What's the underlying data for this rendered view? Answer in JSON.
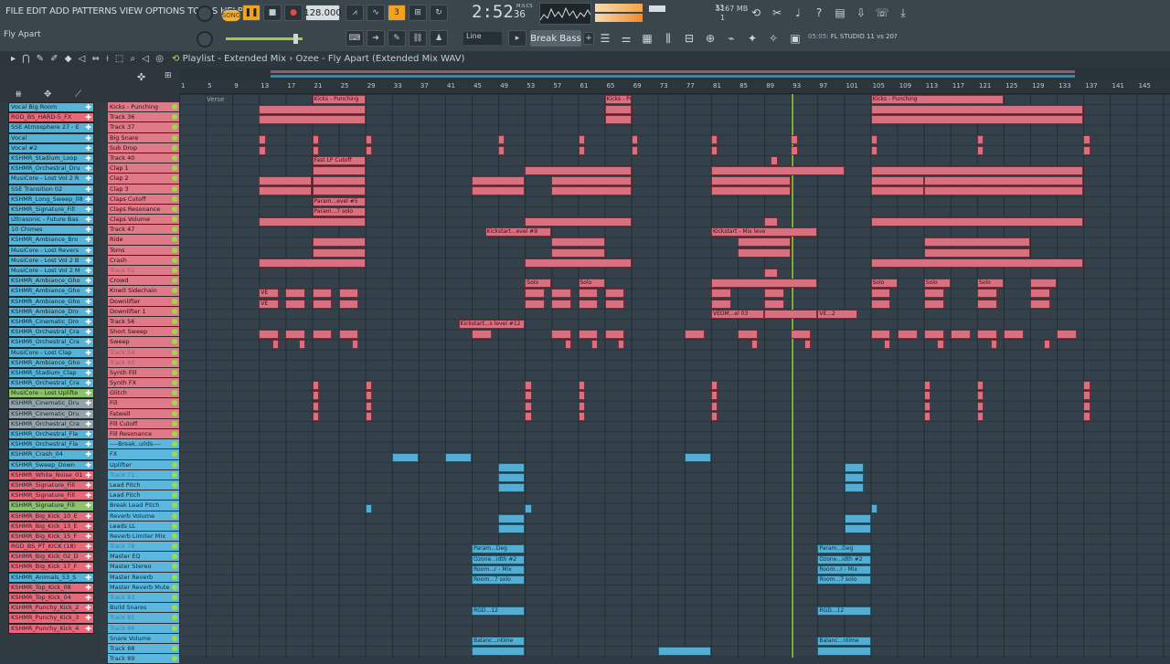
{
  "menu": [
    "FILE",
    "EDIT",
    "ADD",
    "PATTERNS",
    "VIEW",
    "OPTIONS",
    "TOOLS",
    "HELP"
  ],
  "hint_text": "Fly Apart",
  "transport": {
    "mode": "SONG",
    "tempo": "128.000",
    "time": "2:52",
    "time_sub": "36",
    "time_label": "M:S:CS"
  },
  "cpu": {
    "value": "33",
    "memory": "5167 MB",
    "voices": "1"
  },
  "snap": "Line",
  "pattern": "Break Bass",
  "info": {
    "pre": "05:05:",
    "text": "FL STUDIO 11 vs 20?"
  },
  "playlist": {
    "title": "Playlist - Extended Mix",
    "sep": "›",
    "song": "Ozee - Fly Apart (Extended Mix WAV)",
    "marker": "Verse"
  },
  "ruler": [
    "1",
    "5",
    "9",
    "13",
    "17",
    "21",
    "25",
    "29",
    "33",
    "37",
    "41",
    "45",
    "49",
    "53",
    "57",
    "61",
    "65",
    "69",
    "73",
    "77",
    "81",
    "85",
    "89",
    "93",
    "97",
    "101",
    "105",
    "109",
    "113",
    "117",
    "121",
    "125",
    "129",
    "133",
    "137",
    "141",
    "145"
  ],
  "channels": [
    {
      "name": "Vocal Big Room",
      "color": "blue"
    },
    {
      "name": "RGD_BS_HARD-5_FX",
      "color": "red"
    },
    {
      "name": "SSE Atmosphere 27 - E",
      "color": "blue"
    },
    {
      "name": "Vocal",
      "color": "blue"
    },
    {
      "name": "Vocal #2",
      "color": "blue"
    },
    {
      "name": "KSHMR_Stadium_Loop",
      "color": "blue"
    },
    {
      "name": "KSHMR_Orchestral_Dru",
      "color": "blue"
    },
    {
      "name": "MusiCore - Lost Vol 2 R",
      "color": "blue"
    },
    {
      "name": "SSE Transition 02",
      "color": "blue"
    },
    {
      "name": "KSHMR_Long_Sweep_08",
      "color": "blue"
    },
    {
      "name": "KSHMR_Signature_Fill",
      "color": "blue"
    },
    {
      "name": "Ultrasonic - Future Bas",
      "color": "blue"
    },
    {
      "name": "10 Chimes",
      "color": "blue"
    },
    {
      "name": "KSHMR_Ambiance_Bro",
      "color": "blue"
    },
    {
      "name": "MusiCore - Lost Revers",
      "color": "blue"
    },
    {
      "name": "MusiCore - Lost Vol 2 B",
      "color": "blue"
    },
    {
      "name": "MusiCore - Lost Vol 2 M",
      "color": "blue"
    },
    {
      "name": "KSHMR_Ambiance_Gho",
      "color": "blue"
    },
    {
      "name": "KSHMR_Ambiance_Gho",
      "color": "blue"
    },
    {
      "name": "KSHMR_Ambiance_Gho",
      "color": "blue"
    },
    {
      "name": "KSHMR_Ambiance_Dro",
      "color": "blue"
    },
    {
      "name": "KSHMR_Cinematic_Dro",
      "color": "blue"
    },
    {
      "name": "KSHMR_Orchestral_Cra",
      "color": "blue"
    },
    {
      "name": "KSHMR_Orchestral_Cra",
      "color": "blue"
    },
    {
      "name": "MusiCore - Lost Clap",
      "color": "blue"
    },
    {
      "name": "KSHMR_Ambiance_Gho",
      "color": "blue"
    },
    {
      "name": "KSHMR_Stadium_Clap",
      "color": "blue"
    },
    {
      "name": "KSHMR_Orchestral_Cra",
      "color": "blue"
    },
    {
      "name": "MusiCore - Lost Uplifte",
      "color": "green"
    },
    {
      "name": "KSHMR_Cinematic_Dru",
      "color": "grey"
    },
    {
      "name": "KSHMR_Cinematic_Dru",
      "color": "grey"
    },
    {
      "name": "KSHMR_Orchestral_Cra",
      "color": "grey"
    },
    {
      "name": "KSHMR_Orchestral_Fla",
      "color": "blue"
    },
    {
      "name": "KSHMR_Orchestral_Fla",
      "color": "blue"
    },
    {
      "name": "KSHMR_Crash_04",
      "color": "blue"
    },
    {
      "name": "KSHMR_Sweep_Down",
      "color": "blue"
    },
    {
      "name": "KSHMR_White_Noise_01",
      "color": "red"
    },
    {
      "name": "KSHMR_Signature_Fill",
      "color": "red"
    },
    {
      "name": "KSHMR_Signature_Fill",
      "color": "red"
    },
    {
      "name": "KSHMR_Signature_Fill",
      "color": "green"
    },
    {
      "name": "KSHMR_Big_Kick_10_E",
      "color": "red"
    },
    {
      "name": "KSHMR_Big_Kick_13_E",
      "color": "red"
    },
    {
      "name": "KSHMR_Big_Kick_15_F",
      "color": "red"
    },
    {
      "name": "RGD_BS_PT_KICK (18)",
      "color": "red"
    },
    {
      "name": "KSHMR_Big_Kick_02_D",
      "color": "red"
    },
    {
      "name": "KSHMR_Big_Kick_17_F",
      "color": "red"
    },
    {
      "name": "KSHMR_Animals_53_S",
      "color": "blue"
    },
    {
      "name": "KSHMR_Top_Kick_08",
      "color": "red"
    },
    {
      "name": "KSHMR_Top_Kick_04",
      "color": "red"
    },
    {
      "name": "KSHMR_Punchy_Kick_2",
      "color": "red"
    },
    {
      "name": "KSHMR_Punchy_Kick_3",
      "color": "red"
    },
    {
      "name": "KSHMR_Punchy_Kick_4",
      "color": "red"
    }
  ],
  "tracks": [
    {
      "name": "Kicks - Punching",
      "color": "red",
      "faded": false
    },
    {
      "name": "Track 36",
      "color": "red",
      "faded": false
    },
    {
      "name": "Track 37",
      "color": "red",
      "faded": false
    },
    {
      "name": "Big Snare",
      "color": "red",
      "faded": false
    },
    {
      "name": "Sub Drop",
      "color": "red",
      "faded": false
    },
    {
      "name": "Track 40",
      "color": "red",
      "faded": false
    },
    {
      "name": "Clap 1",
      "color": "red",
      "faded": false
    },
    {
      "name": "Clap 2",
      "color": "red",
      "faded": false
    },
    {
      "name": "Clap 3",
      "color": "red",
      "faded": false
    },
    {
      "name": "Claps Cutoff",
      "color": "red",
      "faded": false
    },
    {
      "name": "Claps Resonance",
      "color": "red",
      "faded": false
    },
    {
      "name": "Claps Volume",
      "color": "red",
      "faded": false
    },
    {
      "name": "Track 47",
      "color": "red",
      "faded": false
    },
    {
      "name": "Ride",
      "color": "red",
      "faded": false
    },
    {
      "name": "Toms",
      "color": "red",
      "faded": false
    },
    {
      "name": "Crash",
      "color": "red",
      "faded": false
    },
    {
      "name": "Track 51",
      "color": "red",
      "faded": true
    },
    {
      "name": "Crowd",
      "color": "red",
      "faded": false
    },
    {
      "name": "Knwit Sidechain",
      "color": "red",
      "faded": false
    },
    {
      "name": "Downlifter",
      "color": "red",
      "faded": false
    },
    {
      "name": "Downlifter 1",
      "color": "red",
      "faded": false
    },
    {
      "name": "Track 56",
      "color": "red",
      "faded": false
    },
    {
      "name": "Short Sweep",
      "color": "red",
      "faded": false
    },
    {
      "name": "Sweep",
      "color": "red",
      "faded": false
    },
    {
      "name": "Track 59",
      "color": "red",
      "faded": true
    },
    {
      "name": "Track 60",
      "color": "red",
      "faded": true
    },
    {
      "name": "Synth Fill",
      "color": "red",
      "faded": false
    },
    {
      "name": "Synth FX",
      "color": "red",
      "faded": false
    },
    {
      "name": "Glitch",
      "color": "red",
      "faded": false
    },
    {
      "name": "Fill",
      "color": "red",
      "faded": false
    },
    {
      "name": "Fatwell",
      "color": "red",
      "faded": false
    },
    {
      "name": "Fill Cutoff",
      "color": "red",
      "faded": false
    },
    {
      "name": "Fill Resonance",
      "color": "red",
      "faded": false
    },
    {
      "name": "----Break..uilds----",
      "color": "blue",
      "faded": false
    },
    {
      "name": "FX",
      "color": "blue",
      "faded": false
    },
    {
      "name": "Uplifter",
      "color": "blue",
      "faded": false
    },
    {
      "name": "Track 71",
      "color": "blue",
      "faded": true
    },
    {
      "name": "Lead Pitch",
      "color": "blue",
      "faded": false
    },
    {
      "name": "Lead Pitch",
      "color": "blue",
      "faded": false
    },
    {
      "name": "Break Lead Pitch",
      "color": "blue",
      "faded": false
    },
    {
      "name": "Reverb Volume",
      "color": "blue",
      "faded": false
    },
    {
      "name": "Leads LL",
      "color": "blue",
      "faded": false
    },
    {
      "name": "Reverb Limiter Mix",
      "color": "blue",
      "faded": false
    },
    {
      "name": "Track 78",
      "color": "blue",
      "faded": true
    },
    {
      "name": "Master EQ",
      "color": "blue",
      "faded": false
    },
    {
      "name": "Master Stereo",
      "color": "blue",
      "faded": false
    },
    {
      "name": "Master Reverb",
      "color": "blue",
      "faded": false
    },
    {
      "name": "Master Reverb Mute",
      "color": "blue",
      "faded": false
    },
    {
      "name": "Track 83",
      "color": "blue",
      "faded": true
    },
    {
      "name": "Build Snares",
      "color": "blue",
      "faded": false
    },
    {
      "name": "Track 85",
      "color": "blue",
      "faded": true
    },
    {
      "name": "Track 86",
      "color": "blue",
      "faded": true
    },
    {
      "name": "Snare Volume",
      "color": "blue",
      "faded": false
    },
    {
      "name": "Track 88",
      "color": "blue",
      "faded": false
    },
    {
      "name": "Track 89",
      "color": "blue",
      "faded": false
    }
  ],
  "clip_labels": {
    "fast_lp": "Fast LP Cutoff",
    "param_level5": "Param...evel #5",
    "param_solo": "Param...7 solo",
    "kickstart_level9": "Kickstart...evel #9",
    "kickstart_mix": "Kickstart - Mix leve",
    "kickstart_level12": "Kickstart...s level #12",
    "solo": "Solo",
    "ve": "VE",
    "vedm": "VEDM...el 03",
    "ve_2": "VE...2",
    "param_deg": "Param...Deg",
    "ozone": "Ozone...idth #2",
    "room_mix": "Room...r - Mix",
    "room_solo": "Room...7 solo",
    "rgd": "RGD...12",
    "kicks_punch": "Kicks - Punching",
    "balanc": "Balanc...ntime"
  },
  "colors": {
    "track_red": "#e07a88",
    "track_blue": "#5cb7de",
    "clip_red": "#d8707f",
    "clip_blue": "#54aed4",
    "playhead": "#7fae32",
    "accent_orange": "#f2a21e"
  },
  "icons": [
    "song-mode-icon",
    "play-icon",
    "stop-icon",
    "record-icon",
    "metronome-icon",
    "undo-icon",
    "save-icon",
    "mixer-icon",
    "channel-rack-icon",
    "piano-roll-icon",
    "browser-icon",
    "plugin-icon",
    "help-icon",
    "snap-icon",
    "magnet-icon",
    "draw-icon",
    "paint-icon",
    "delete-icon",
    "mute-icon",
    "slip-icon",
    "select-icon",
    "zoom-icon",
    "playback-icon"
  ]
}
